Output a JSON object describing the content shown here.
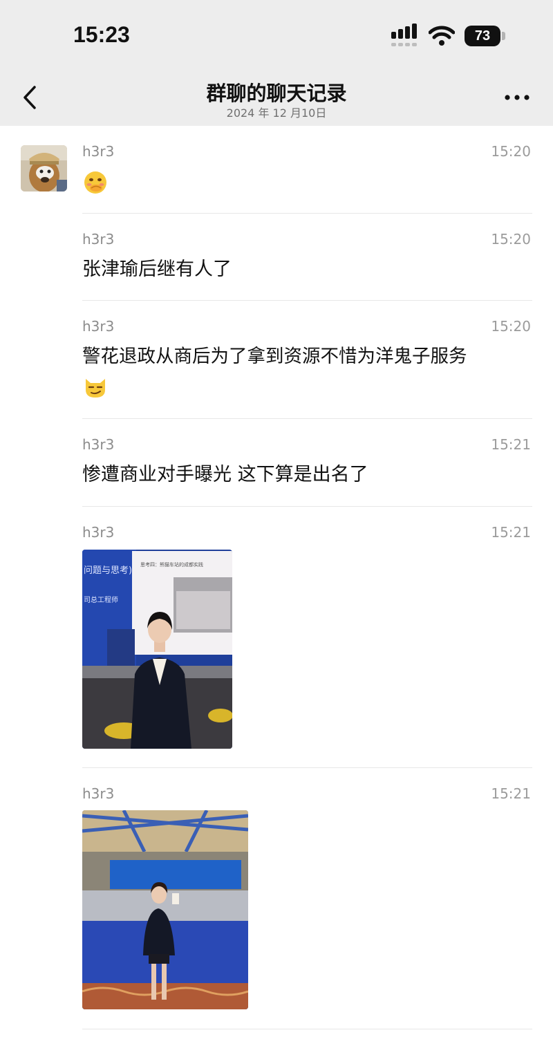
{
  "status_bar": {
    "time": "15:23",
    "battery": "73"
  },
  "nav": {
    "title": "群聊的聊天记录",
    "subtitle": "2024 年 12 月10日"
  },
  "messages": [
    {
      "sender": "h3r3",
      "time": "15:20",
      "text": "",
      "emoji": "face-with-hand-over-mouth-emoji"
    },
    {
      "sender": "h3r3",
      "time": "15:20",
      "text": "张津瑜后继有人了"
    },
    {
      "sender": "h3r3",
      "time": "15:20",
      "text": "警花退政从商后为了拿到资源不惜为洋鬼子服务",
      "emoji": "smirking-cat-emoji"
    },
    {
      "sender": "h3r3",
      "time": "15:21",
      "text": "惨遭商业对手曝光 这下算是出名了"
    },
    {
      "sender": "h3r3",
      "time": "15:21",
      "text": "",
      "image": "photo-woman-in-suit-at-conference"
    },
    {
      "sender": "h3r3",
      "time": "15:21",
      "text": "",
      "image": "photo-woman-at-event-hall"
    }
  ],
  "photo1_slide": {
    "heading": "问题与思考)",
    "caption": "司总工程师",
    "slide_title": "思考四：熊猫车站的成都实践"
  },
  "colors": {
    "topbar_bg": "#ededed",
    "divider": "#e7e7e7",
    "meta_text": "#8c8c8c"
  }
}
